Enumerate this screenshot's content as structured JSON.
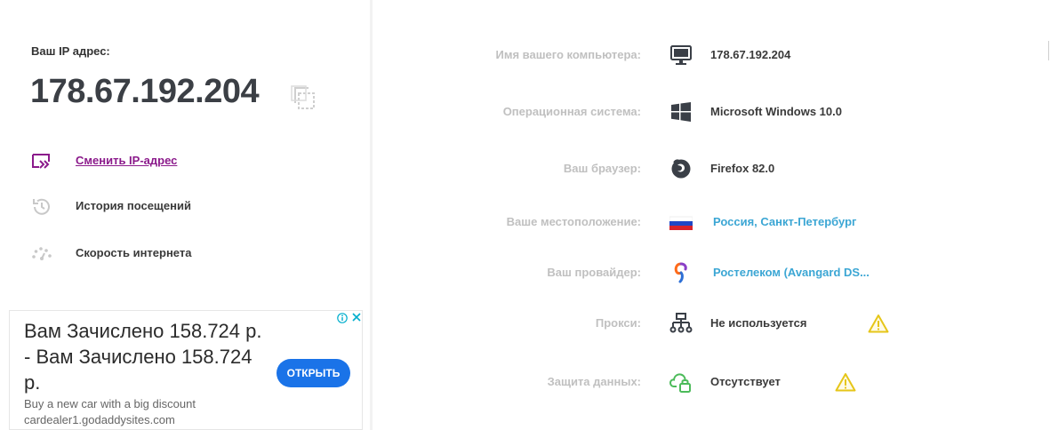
{
  "ip": {
    "label": "Ваш IP адрес:",
    "value": "178.67.192.204"
  },
  "menu": [
    {
      "label": "Сменить IP-адрес",
      "icon": "switch-ip-icon",
      "active": true
    },
    {
      "label": "История посещений",
      "icon": "history-icon",
      "active": false
    },
    {
      "label": "Скорость интернета",
      "icon": "speedometer-icon",
      "active": false
    }
  ],
  "ad": {
    "title": "Вам Зачислено 158.724 р. - Вам Зачислено 158.724 р.",
    "description": "Buy a new car with a big discount",
    "domain": "cardealer1.godaddysites.com",
    "button": "ОТКРЫТЬ",
    "info_icon": "info-icon",
    "close_icon": "close-icon"
  },
  "details": [
    {
      "key": "Имя вашего компьютера:",
      "value": "178.67.192.204",
      "icon": "monitor-icon",
      "link": false
    },
    {
      "key": "Операционная система:",
      "value": "Microsoft Windows 10.0",
      "icon": "windows-icon",
      "link": false
    },
    {
      "key": "Ваш браузер:",
      "value": "Firefox 82.0",
      "icon": "firefox-icon",
      "link": false
    },
    {
      "key": "Ваше местоположение:",
      "value": "Россия, Санкт-Петербург",
      "icon": "russia-flag-icon",
      "link": true
    },
    {
      "key": "Ваш провайдер:",
      "value": "Ростелеком (Avangard DS...",
      "icon": "rostelecom-icon",
      "link": true
    },
    {
      "key": "Прокси:",
      "value": "Не используется",
      "icon": "proxy-network-icon",
      "link": false,
      "warning": true
    },
    {
      "key": "Защита данных:",
      "value": "Отсутствует",
      "icon": "cloud-lock-icon",
      "link": false,
      "warning": true
    }
  ],
  "colors": {
    "accent_purple": "#8b1a8b",
    "link_blue": "#3ba6d4",
    "warning_yellow": "#e6c619",
    "label_gray": "#c0c0c0",
    "ad_button": "#1a73e8",
    "cloud_green": "#4cbb5a"
  }
}
